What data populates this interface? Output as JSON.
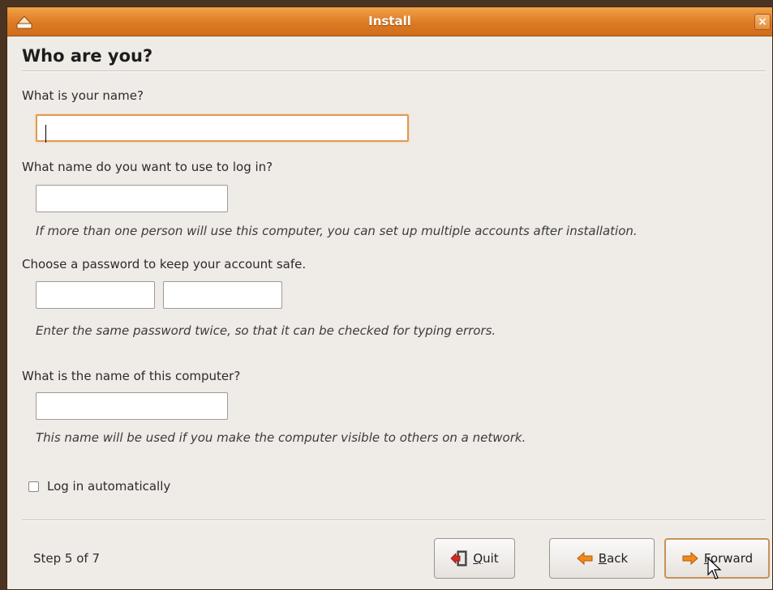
{
  "window": {
    "title": "Install",
    "close_glyph": "×",
    "app_icon": "ubuntu-installer-icon"
  },
  "page": {
    "heading": "Who are you?"
  },
  "form": {
    "name_label": "What is your name?",
    "name_value": "",
    "login_label": "What name do you want to use to log in?",
    "login_value": "",
    "login_hint": "If more than one person will use this computer, you can set up multiple accounts after installation.",
    "password_label": "Choose a password to keep your account safe.",
    "password_value": "",
    "password_confirm_value": "",
    "password_hint": "Enter the same password twice, so that it can be checked for typing errors.",
    "computer_label": "What is the name of this computer?",
    "computer_value": "",
    "computer_hint": "This name will be used if you make the computer visible to others on a network.",
    "autologin_label": "Log in automatically",
    "autologin_checked": false
  },
  "footer": {
    "step_text": "Step 5 of 7",
    "quit_label": "Quit",
    "back_label": "Back",
    "forward_label": "Forward"
  },
  "icons": {
    "quit": "quit-door-icon",
    "back": "back-arrow-icon",
    "forward": "forward-arrow-icon"
  },
  "colors": {
    "titlebar": "#dd7a24",
    "focus_border": "#e09a52",
    "window_bg": "#efebe7",
    "quit_icon": "#d42a1e",
    "arrow_icon": "#f08a1e"
  }
}
